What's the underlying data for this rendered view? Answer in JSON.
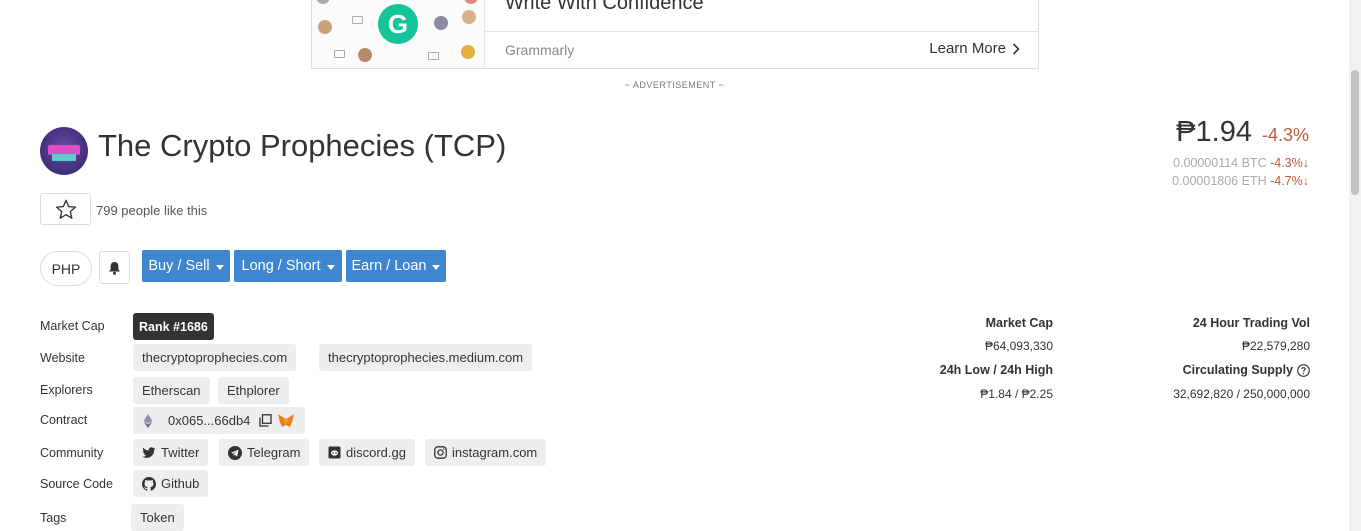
{
  "ad": {
    "headline": "Write With Confidence",
    "brand": "Grammarly",
    "cta": "Learn More",
    "logo_letter": "G",
    "label": "~ ADVERTISEMENT ~",
    "brand_color": "#15c39a"
  },
  "coin": {
    "title": "The Crypto Prophecies (TCP)",
    "likes": "799 people like this",
    "price": "₱1.94",
    "change": "-4.3%",
    "btc_price": "0.00000114 BTC",
    "btc_change": "-4.3%",
    "eth_price": "0.00001806 ETH",
    "eth_change": "-4.7%",
    "negative_color": "#c05a3c"
  },
  "actions": {
    "currency": "PHP",
    "buy_sell": "Buy / Sell",
    "long_short": "Long / Short",
    "earn_loan": "Earn / Loan",
    "button_color": "#3e87d0"
  },
  "info": {
    "market_cap_label": "Market Cap",
    "rank": "Rank #1686",
    "website_label": "Website",
    "websites": [
      "thecryptoprophecies.com",
      "thecryptoprophecies.medium.com"
    ],
    "explorers_label": "Explorers",
    "explorers": [
      "Etherscan",
      "Ethplorer"
    ],
    "contract_label": "Contract",
    "contract": "0x065...66db4",
    "community_label": "Community",
    "community": [
      "Twitter",
      "Telegram",
      "discord.gg",
      "instagram.com"
    ],
    "source_label": "Source Code",
    "source": "Github",
    "tags_label": "Tags",
    "tags": [
      "Token"
    ]
  },
  "stats": {
    "market_cap_label": "Market Cap",
    "market_cap": "₱64,093,330",
    "volume_label": "24 Hour Trading Vol",
    "volume": "₱22,579,280",
    "range_label": "24h Low / 24h High",
    "range": "₱1.84 / ₱2.25",
    "supply_label": "Circulating Supply",
    "supply": "32,692,820 / 250,000,000"
  }
}
